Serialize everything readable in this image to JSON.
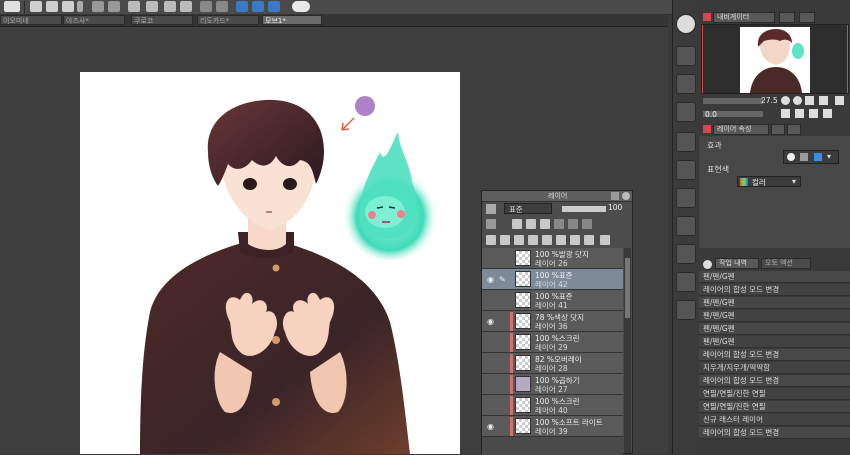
{
  "tabs": [
    {
      "label": "이오미네"
    },
    {
      "label": "야즈사*"
    },
    {
      "label": "쿠로코"
    },
    {
      "label": "리도카드*"
    },
    {
      "label": "모브1*"
    }
  ],
  "navigator": {
    "tabs": [
      "내비게이터",
      ""
    ],
    "zoom": "27.5",
    "rotation": "0.0"
  },
  "layer_property": {
    "tab": "레이어 속성",
    "effect_label": "효과",
    "expression_label": "표현색",
    "expression_value": "컬러"
  },
  "history": {
    "tab1": "작업 내역",
    "tab2": "오토 액션",
    "items": [
      "펜/펜/G펜",
      "레이어의 합성 모드 변경",
      "펜/펜/G펜",
      "펜/펜/G펜",
      "펜/펜/G펜",
      "펜/펜/G펜",
      "레이어의 합성 모드 변경",
      "지우개/지우개/딱딱함",
      "레이어의 합성 모드 변경",
      "연필/연필/진한 연필",
      "연필/연필/진한 연필",
      "신규 래스터 레이어",
      "레이어의 합성 모드 변경"
    ]
  },
  "layers_panel": {
    "title": "레이어",
    "blend_mode": "표준",
    "opacity": "100",
    "layers": [
      {
        "line1": "100 %발광 닷지",
        "line2": "레이어 26",
        "visible": false,
        "selected": false
      },
      {
        "line1": "100 %표준",
        "line2": "레이어 42",
        "visible": true,
        "selected": true
      },
      {
        "line1": "100 %표준",
        "line2": "레이어 41",
        "visible": false,
        "selected": false
      },
      {
        "line1": "78 %색상 닷지",
        "line2": "레이어 36",
        "visible": true,
        "selected": false
      },
      {
        "line1": "100 %스크린",
        "line2": "레이어 29",
        "visible": false,
        "selected": false
      },
      {
        "line1": "82 %오버레이",
        "line2": "레이어 28",
        "visible": false,
        "selected": false
      },
      {
        "line1": "100 %곱하기",
        "line2": "레이어 27",
        "visible": false,
        "selected": false
      },
      {
        "line1": "100 %스크린",
        "line2": "레이어 40",
        "visible": false,
        "selected": false
      },
      {
        "line1": "100 %소프트 라이트",
        "line2": "레이어 39",
        "visible": true,
        "selected": false
      }
    ]
  },
  "colors": {
    "accent": "#d44a4a",
    "selected_layer": "#7d8b99",
    "canvas_bg": "#ffffff"
  }
}
